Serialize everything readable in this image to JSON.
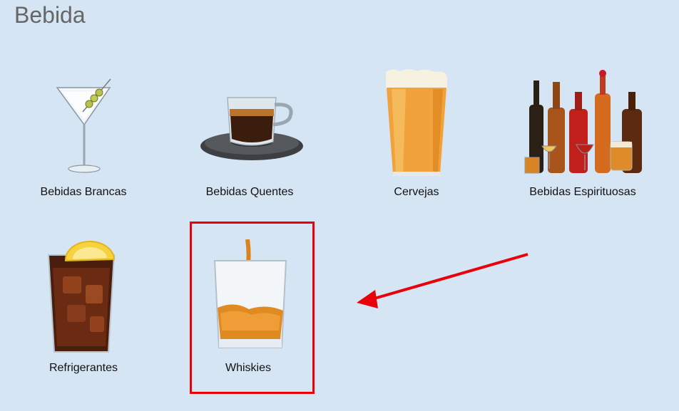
{
  "page": {
    "title": "Bebida"
  },
  "categories": [
    {
      "label": "Bebidas Brancas",
      "icon": "martini-glass-icon"
    },
    {
      "label": "Bebidas Quentes",
      "icon": "espresso-cup-icon"
    },
    {
      "label": "Cervejas",
      "icon": "beer-glass-icon"
    },
    {
      "label": "Bebidas Espirituosas",
      "icon": "liquor-bottles-icon"
    },
    {
      "label": "Refrigerantes",
      "icon": "cola-glass-icon"
    },
    {
      "label": "Whiskies",
      "icon": "whiskey-glass-icon"
    }
  ],
  "annotation": {
    "highlight_color": "#e8000b",
    "highlighted_item": "Whiskies"
  }
}
